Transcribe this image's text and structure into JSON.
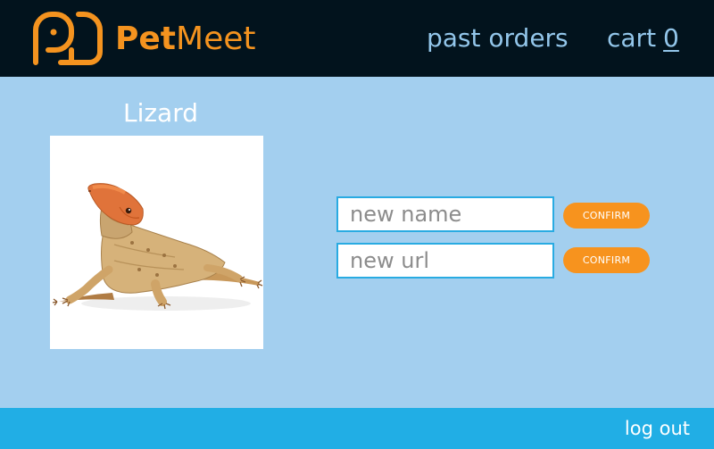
{
  "header": {
    "brand_part1": "Pet",
    "brand_part2": "Meet",
    "nav": {
      "past_orders": "past orders",
      "cart_label": "cart",
      "cart_count": "0"
    }
  },
  "pet": {
    "name": "Lizard",
    "image": "lizard-photo"
  },
  "form": {
    "name_placeholder": "new name",
    "name_confirm": "CONFIRM",
    "url_placeholder": "new url",
    "url_confirm": "CONFIRM"
  },
  "footer": {
    "logout": "log out"
  },
  "colors": {
    "header_bg": "#02131d",
    "page_bg": "#a3cfef",
    "brand": "#f4931f",
    "nav": "#93c6ea",
    "accent_button": "#f7931e",
    "footer_bg": "#21aee5"
  }
}
